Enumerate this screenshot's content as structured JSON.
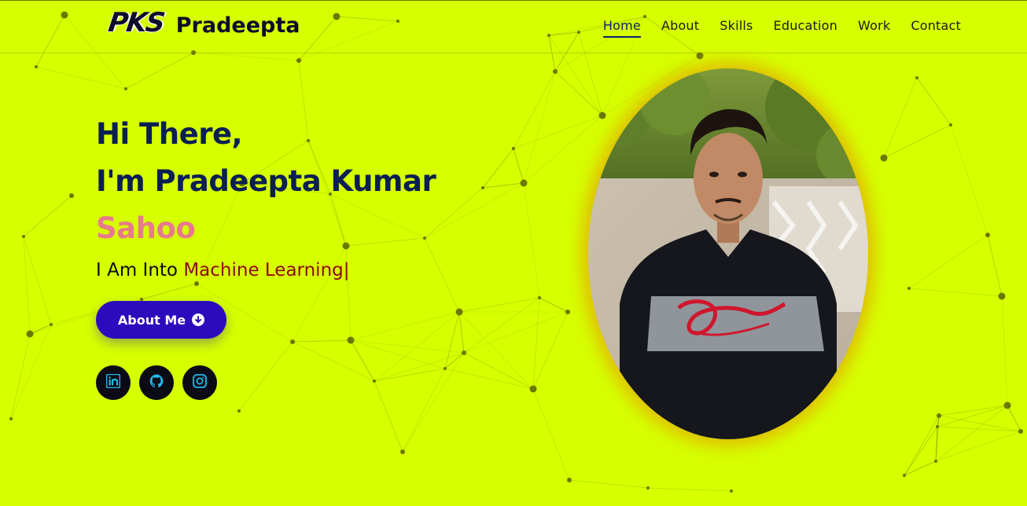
{
  "brand": {
    "logo_text": "PKS",
    "name": "Pradeepta"
  },
  "nav": {
    "items": [
      {
        "label": "Home",
        "active": true
      },
      {
        "label": "About",
        "active": false
      },
      {
        "label": "Skills",
        "active": false
      },
      {
        "label": "Education",
        "active": false
      },
      {
        "label": "Work",
        "active": false
      },
      {
        "label": "Contact",
        "active": false
      }
    ]
  },
  "hero": {
    "greeting": "Hi There,",
    "intro": "I'm Pradeepta Kumar",
    "surname": "Sahoo",
    "into_prefix": "I Am Into",
    "into_typed": "Machine Learning|",
    "about_button": "About Me"
  },
  "socials": [
    {
      "name": "linkedin-icon"
    },
    {
      "name": "github-icon"
    },
    {
      "name": "instagram-icon"
    }
  ],
  "colors": {
    "background": "#d6ff00",
    "heading": "#0b1f52",
    "surname": "#e77b8b",
    "typed": "#8a0a0a",
    "button": "#2c0bbd",
    "nav_active": "#0a2472",
    "social_icon": "#22b7e6"
  }
}
